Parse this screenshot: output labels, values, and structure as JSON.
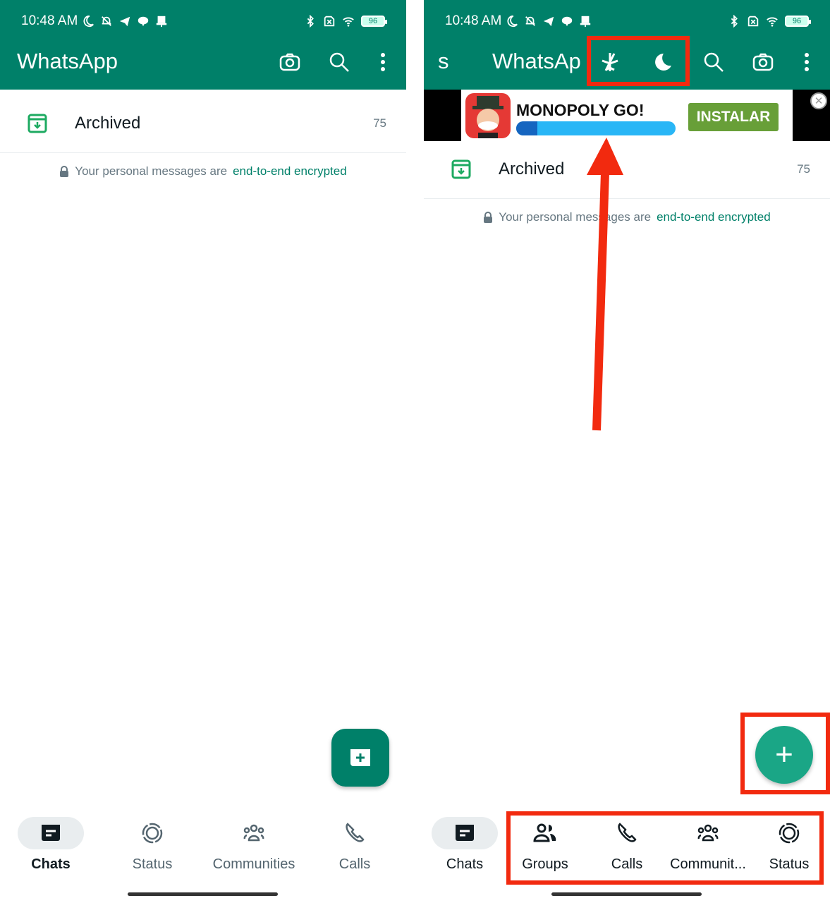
{
  "status_bar": {
    "time": "10:48 AM",
    "battery": "96"
  },
  "left": {
    "app_title": "WhatsApp",
    "archived": {
      "label": "Archived",
      "count": "75"
    },
    "encryption": {
      "text": "Your personal messages are",
      "link": "end-to-end encrypted"
    },
    "nav": [
      {
        "label": "Chats",
        "icon": "chats-icon",
        "active": true
      },
      {
        "label": "Status",
        "icon": "status-icon"
      },
      {
        "label": "Communities",
        "icon": "communities-icon"
      },
      {
        "label": "Calls",
        "icon": "calls-icon"
      }
    ]
  },
  "right": {
    "title_prefix": "s",
    "app_title": "WhatsAp",
    "ad": {
      "title": "MONOPOLY GO!",
      "button": "INSTALAR"
    },
    "archived": {
      "label": "Archived",
      "count": "75"
    },
    "encryption": {
      "text": "Your personal messages are",
      "link": "end-to-end encrypted"
    },
    "fab": "+",
    "nav": [
      {
        "label": "Chats",
        "icon": "chats-icon",
        "active": true
      },
      {
        "label": "Groups",
        "icon": "groups-icon"
      },
      {
        "label": "Calls",
        "icon": "calls-icon"
      },
      {
        "label": "Communit...",
        "icon": "communities-icon"
      },
      {
        "label": "Status",
        "icon": "status-icon"
      }
    ]
  },
  "colors": {
    "brand": "#008069",
    "annotation": "#f22a0f",
    "fab_right": "#1aa686"
  }
}
